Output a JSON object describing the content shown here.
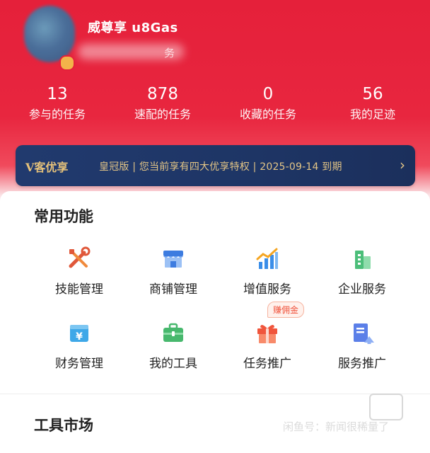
{
  "profile": {
    "username": "威尊享 u8Gas",
    "subtitle_suffix": "务"
  },
  "stats": [
    {
      "value": "13",
      "label": "参与的任务"
    },
    {
      "value": "878",
      "label": "速配的任务"
    },
    {
      "value": "0",
      "label": "收藏的任务"
    },
    {
      "value": "56",
      "label": "我的足迹"
    }
  ],
  "vip": {
    "brand": "V客优享",
    "text": "皇冠版 | 您当前享有四大优享特权 | 2025-09-14 到期",
    "arrow": "›"
  },
  "common_functions": {
    "title": "常用功能",
    "items": [
      {
        "label": "技能管理",
        "icon": "tools-icon"
      },
      {
        "label": "商铺管理",
        "icon": "shop-icon"
      },
      {
        "label": "增值服务",
        "icon": "growth-chart-icon"
      },
      {
        "label": "企业服务",
        "icon": "building-icon"
      },
      {
        "label": "财务管理",
        "icon": "yuan-wallet-icon"
      },
      {
        "label": "我的工具",
        "icon": "toolbox-icon"
      },
      {
        "label": "任务推广",
        "icon": "gift-icon",
        "tag": "赚佣金"
      },
      {
        "label": "服务推广",
        "icon": "document-upload-icon"
      }
    ]
  },
  "tool_market": {
    "title": "工具市场"
  },
  "watermark": {
    "text": "闲鱼号：新闻很稀量了"
  },
  "colors": {
    "brand_red": "#e5203a",
    "vip_navy": "#1e3565",
    "vip_gold": "#e3c586"
  }
}
